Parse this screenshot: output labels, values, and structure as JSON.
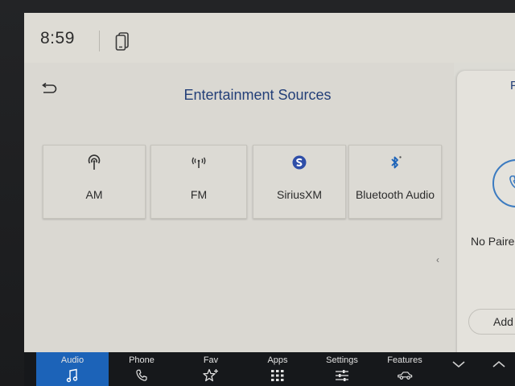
{
  "status": {
    "time": "8:59"
  },
  "main": {
    "title": "Entertainment Sources",
    "sources": [
      {
        "label": "AM",
        "icon": "am-antenna-icon"
      },
      {
        "label": "FM",
        "icon": "fm-broadcast-icon"
      },
      {
        "label": "SiriusXM",
        "icon": "siriusxm-logo-icon"
      },
      {
        "label": "Bluetooth Audio",
        "icon": "bluetooth-icon"
      }
    ]
  },
  "phone_panel": {
    "title": "P",
    "status_text": "No Paire",
    "add_label": "Add Ph"
  },
  "nav": {
    "items": [
      {
        "label": "Audio",
        "icon": "music-note-icon",
        "active": true
      },
      {
        "label": "Phone",
        "icon": "phone-handset-icon"
      },
      {
        "label": "Fav",
        "icon": "star-plus-icon"
      },
      {
        "label": "Apps",
        "icon": "apps-grid-icon"
      },
      {
        "label": "Settings",
        "icon": "sliders-icon"
      },
      {
        "label": "Features",
        "icon": "car-icon"
      }
    ]
  },
  "colors": {
    "accent": "#1c63b8",
    "title_blue": "#233f78",
    "screen_bg": "#dad8d2",
    "nav_bg": "#16181b"
  }
}
